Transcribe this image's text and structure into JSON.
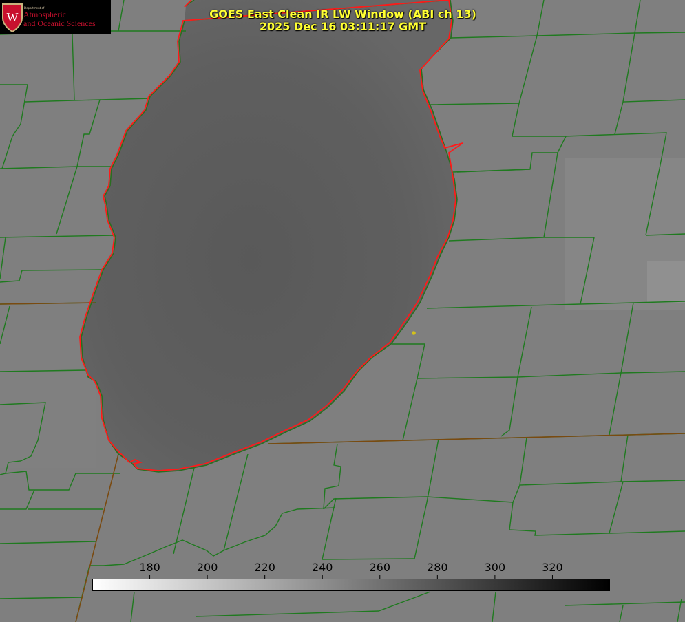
{
  "title": {
    "line1": "GOES East Clean IR LW Window (ABI ch 13)",
    "line2": "2025 Dec 16 03:11:17 GMT"
  },
  "logo": {
    "department": "Department of",
    "line1": "Atmospheric",
    "line2": "and Oceanic Sciences",
    "crest_letter": "W"
  },
  "colorbar": {
    "min": 160,
    "max": 340,
    "ticks": [
      180,
      200,
      220,
      240,
      260,
      280,
      300,
      320
    ],
    "scale": "white to black (warm values dark)"
  },
  "colors": {
    "background": "#7f7f7f",
    "lake": "#5e5e5e",
    "county_lines": "#1f7a1f",
    "shoreline": "#ff1a1a",
    "title_text": "#ffff33",
    "marker": "#d4c21a"
  },
  "marker": "yellow-point"
}
